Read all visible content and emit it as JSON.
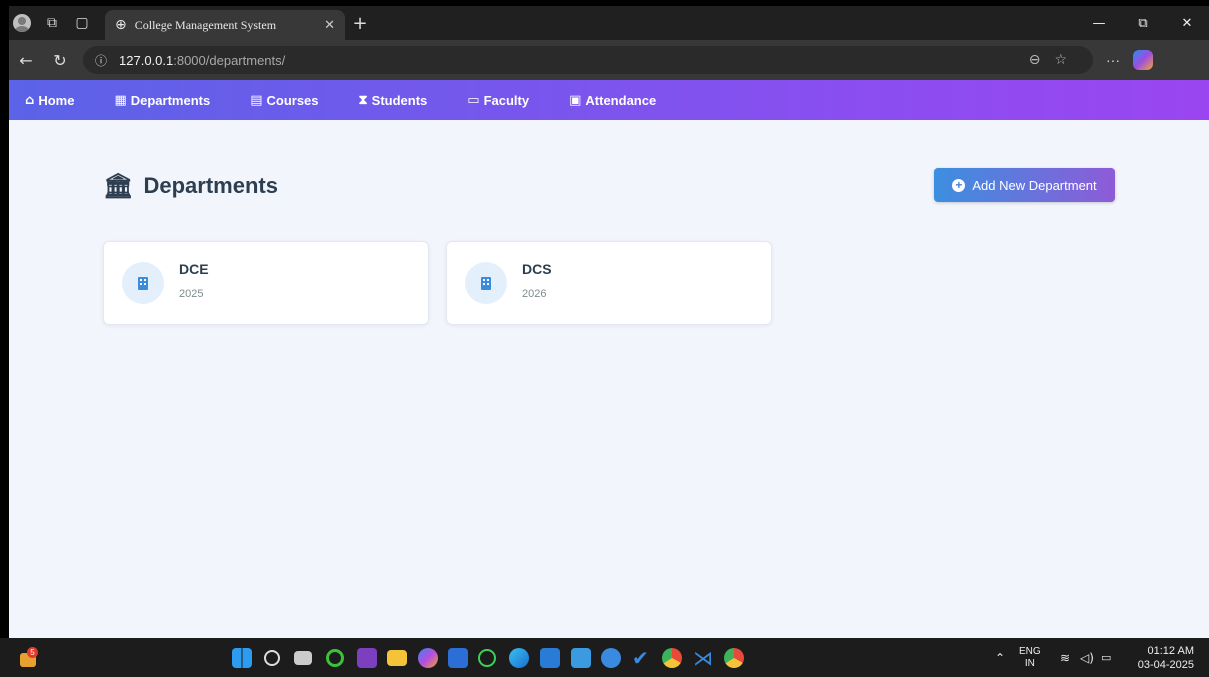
{
  "browser": {
    "tab_title": "College Management System",
    "url_host": "127.0.0.1",
    "url_path": ":8000/departments/"
  },
  "navbar": {
    "items": [
      {
        "label": "Home",
        "icon": "house-icon"
      },
      {
        "label": "Departments",
        "icon": "building-icon"
      },
      {
        "label": "Courses",
        "icon": "book-icon"
      },
      {
        "label": "Students",
        "icon": "graduate-icon"
      },
      {
        "label": "Faculty",
        "icon": "chalkboard-teacher-icon"
      },
      {
        "label": "Attendance",
        "icon": "clipboard-check-icon"
      }
    ]
  },
  "page": {
    "title": "Departments",
    "add_button": "Add New Department"
  },
  "departments": [
    {
      "name": "DCE",
      "year": "2025"
    },
    {
      "name": "DCS",
      "year": "2026"
    }
  ],
  "taskbar": {
    "notification_count": "5",
    "lang_top": "ENG",
    "lang_bottom": "IN",
    "time": "01:12 AM",
    "date": "03-04-2025"
  },
  "colors": {
    "nav_gradient_start": "#5b63e8",
    "nav_gradient_end": "#9a46f0",
    "page_bg": "#f2f6fc",
    "heading": "#2c3e50"
  }
}
